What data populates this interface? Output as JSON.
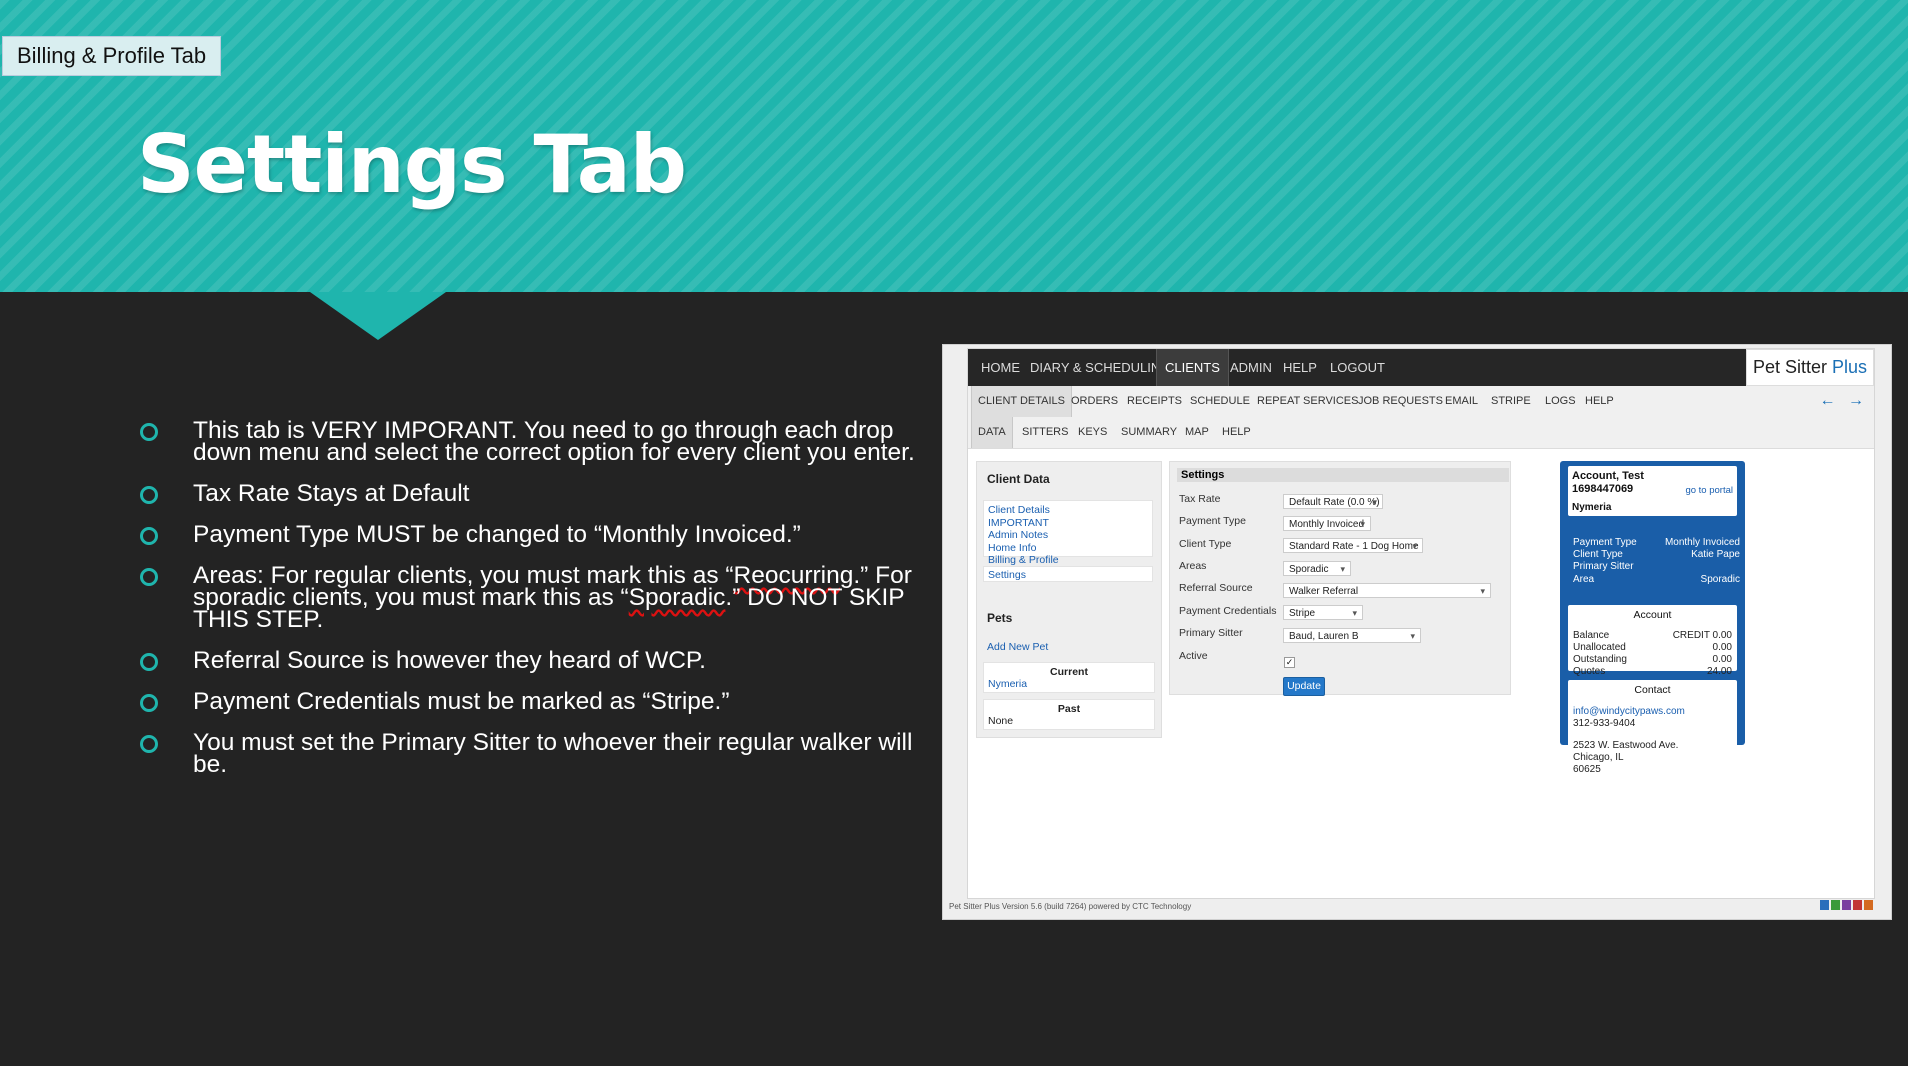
{
  "section_label": "Billing & Profile Tab",
  "title": "Settings Tab",
  "bullets": [
    {
      "pre": "This tab is VERY IMPORANT. You need to go through each drop down menu and select the correct option for every client you enter."
    },
    {
      "pre": "Tax Rate Stays at Default"
    },
    {
      "pre": "Payment Type MUST be changed to “Monthly Invoiced.”"
    },
    {
      "pre": "Areas: For regular clients, you must mark this as “",
      "typo1": "Reocurring",
      "mid": ".” For sporadic clients, you must mark this as “",
      "typo2": "Sporadic",
      "post": ".” DO NOT SKIP THIS STEP."
    },
    {
      "pre": "Referral Source is however they heard of WCP."
    },
    {
      "pre": "Payment Credentials must be marked as “Stripe.”"
    },
    {
      "pre": "You must set the Primary Sitter to whoever their regular walker will be."
    }
  ],
  "app": {
    "top_nav": [
      "HOME",
      "DIARY & SCHEDULING",
      "CLIENTS",
      "ADMIN",
      "HELP",
      "LOGOUT"
    ],
    "brand": {
      "name": "Pet Sitter",
      "suffix": "Plus"
    },
    "sub_nav": [
      "CLIENT DETAILS",
      "ORDERS",
      "RECEIPTS",
      "SCHEDULE",
      "REPEAT SERVICES",
      "JOB REQUESTS",
      "EMAIL",
      "STRIPE",
      "LOGS",
      "HELP"
    ],
    "tab_nav": [
      "DATA",
      "SITTERS",
      "KEYS",
      "SUMMARY",
      "MAP",
      "HELP"
    ],
    "client_data": {
      "title": "Client Data",
      "links": [
        "Client Details",
        "IMPORTANT",
        "Admin Notes",
        "Home Info",
        "Billing & Profile"
      ],
      "settings_link": "Settings",
      "pets_title": "Pets",
      "add_pet": "Add New Pet",
      "current_label": "Current",
      "current_pet": "Nymeria",
      "past_label": "Past",
      "past_value": "None"
    },
    "settings": {
      "title": "Settings",
      "tax_rate": {
        "label": "Tax Rate",
        "value": "Default Rate (0.0 %)"
      },
      "payment_type": {
        "label": "Payment Type",
        "value": "Monthly Invoiced"
      },
      "client_type": {
        "label": "Client Type",
        "value": "Standard Rate - 1 Dog Home"
      },
      "areas": {
        "label": "Areas",
        "value": "Sporadic"
      },
      "referral_source": {
        "label": "Referral Source",
        "value": "Walker Referral"
      },
      "payment_credentials": {
        "label": "Payment Credentials",
        "value": "Stripe"
      },
      "primary_sitter": {
        "label": "Primary Sitter",
        "value": "Baud, Lauren B"
      },
      "active": {
        "label": "Active",
        "checked": true
      },
      "update_label": "Update"
    },
    "account": {
      "name": "Account, Test",
      "number": "1698447069",
      "portal_link": "go to portal",
      "pet": "Nymeria",
      "payment_type_label": "Payment Type",
      "payment_type_value": "Monthly Invoiced",
      "client_type_label": "Client Type",
      "client_type_value": "Katie Pape",
      "primary_sitter_label": "Primary Sitter",
      "area_label": "Area",
      "area_value": "Sporadic",
      "account_title": "Account",
      "balance_label": "Balance",
      "balance_value": "CREDIT 0.00",
      "unallocated_label": "Unallocated",
      "unallocated_value": "0.00",
      "outstanding_label": "Outstanding",
      "outstanding_value": "0.00",
      "quotes_label": "Quotes",
      "quotes_value": "24.00",
      "contact_title": "Contact",
      "email": "info@windycitypaws.com",
      "phone": "312-933-9404",
      "address1": "2523 W. Eastwood Ave.",
      "address2": "Chicago, IL",
      "zip": "60625"
    },
    "footer": "Pet Sitter Plus Version 5.6 (build 7264) powered by CTC Technology",
    "arrows": "← →",
    "swatch_colors": [
      "#2a6ebb",
      "#3a9a3a",
      "#7a3fa0",
      "#c23535",
      "#d46a20"
    ]
  }
}
